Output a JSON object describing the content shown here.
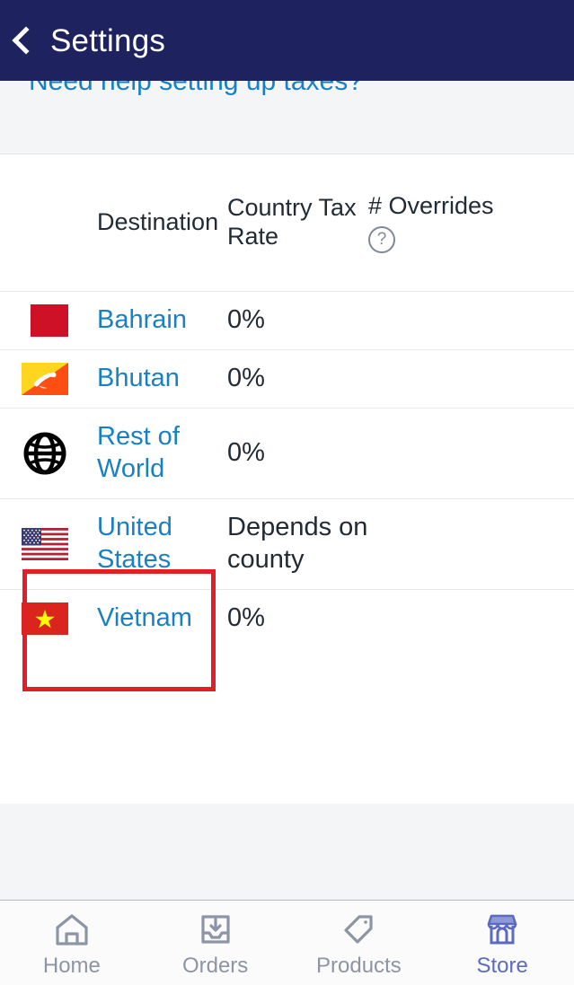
{
  "header": {
    "title": "Settings",
    "back_icon": "chevron-left-icon",
    "background_color": "#1e2360"
  },
  "help_banner": {
    "link_text": "Need help setting up taxes?",
    "link_color": "#1a80c4"
  },
  "table": {
    "columns": [
      {
        "key": "destination",
        "label": "Destination"
      },
      {
        "key": "country_tax_rate",
        "label": "Country Tax Rate"
      },
      {
        "key": "overrides",
        "label": "# Overrides",
        "help_icon": "question-circle-icon"
      }
    ],
    "rows": [
      {
        "flag": "bahrain-flag",
        "destination": "Bahrain",
        "country_tax_rate": "0%",
        "overrides": ""
      },
      {
        "flag": "bhutan-flag",
        "destination": "Bhutan",
        "country_tax_rate": "0%",
        "overrides": ""
      },
      {
        "flag": "globe-icon",
        "destination": "Rest of World",
        "country_tax_rate": "0%",
        "overrides": ""
      },
      {
        "flag": "united-states-flag",
        "destination": "United States",
        "country_tax_rate": "Depends on county",
        "overrides": "",
        "highlighted": true
      },
      {
        "flag": "vietnam-flag",
        "destination": "Vietnam",
        "country_tax_rate": "0%",
        "overrides": ""
      }
    ]
  },
  "annotation": {
    "highlight_color": "#e01f26",
    "target": "United States"
  },
  "bottom_nav": {
    "items": [
      {
        "label": "Home",
        "icon": "home-icon",
        "active": false
      },
      {
        "label": "Orders",
        "icon": "inbox-download-icon",
        "active": false
      },
      {
        "label": "Products",
        "icon": "tag-icon",
        "active": false
      },
      {
        "label": "Store",
        "icon": "storefront-icon",
        "active": true
      }
    ],
    "active_color": "#5c6bc0",
    "inactive_color": "#8c95a5"
  }
}
